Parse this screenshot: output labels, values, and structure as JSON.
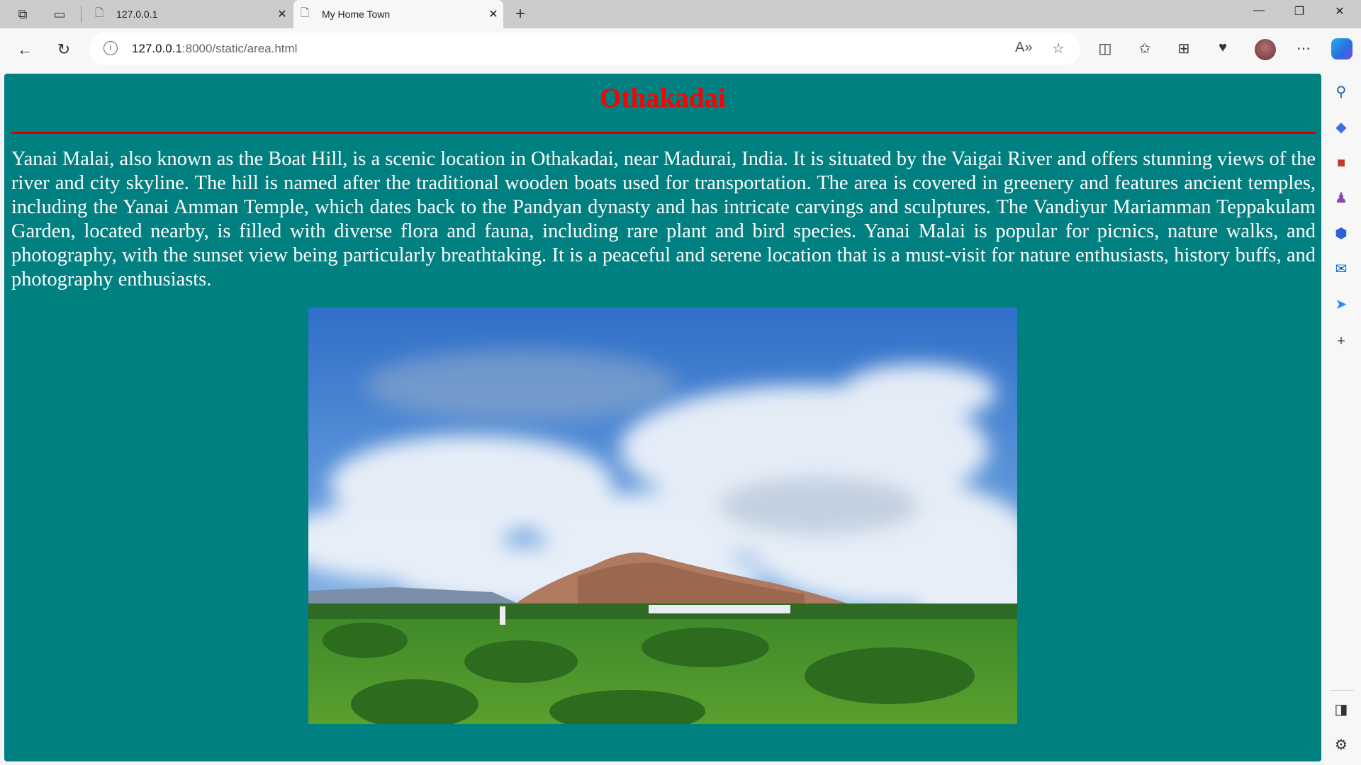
{
  "browser": {
    "tabs": [
      {
        "title": "127.0.0.1",
        "active": false
      },
      {
        "title": "My Home Town",
        "active": true
      }
    ],
    "address": {
      "host": "127.0.0.1",
      "rest": ":8000/static/area.html"
    }
  },
  "page": {
    "title": "Othakadai",
    "paragraph": "Yanai Malai, also known as the Boat Hill, is a scenic location in Othakadai, near Madurai, India. It is situated by the Vaigai River and offers stunning views of the river and city skyline. The hill is named after the traditional wooden boats used for transportation. The area is covered in greenery and features ancient temples, including the Yanai Amman Temple, which dates back to the Pandyan dynasty and has intricate carvings and sculptures. The Vandiyur Mariamman Teppakulam Garden, located nearby, is filled with diverse flora and fauna, including rare plant and bird species. Yanai Malai is popular for picnics, nature walks, and photography, with the sunset view being particularly breathtaking. It is a peaceful and serene location that is a must-visit for nature enthusiasts, history buffs, and photography enthusiasts.",
    "colors": {
      "background": "#008080",
      "title": "#ff0000",
      "text": "#ffffff"
    }
  }
}
